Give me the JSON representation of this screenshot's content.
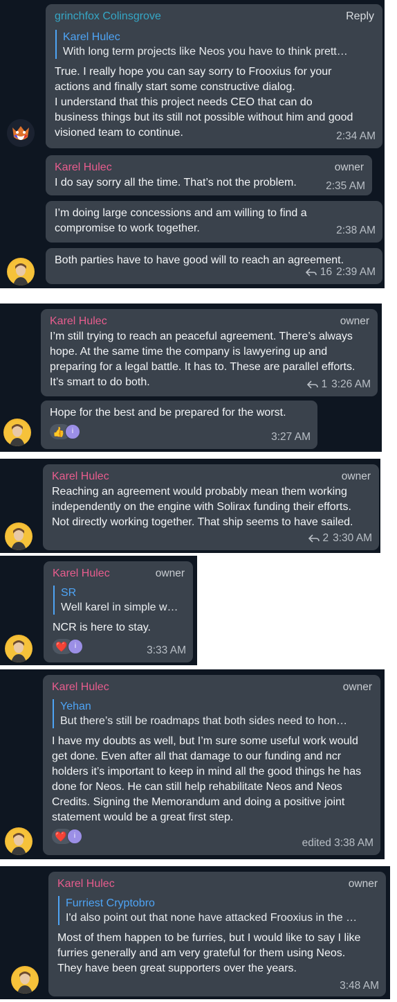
{
  "colors": {
    "background": "#0e1621",
    "bubble": "#3a424c",
    "owner_name": "#e85d8e",
    "other_name": "#35a7c6",
    "quote_bar": "#4ea4f5"
  },
  "panel1": {
    "msg1": {
      "author": "grinchfox Colinsgrove",
      "reply_label": "Reply",
      "quote_author": "Karel Hulec",
      "quote_text": "With long term projects like Neos you have to think prett…",
      "text": "True. I really hope you can say sorry to Frooxius for your actions and finally start some constructive dialog.\nI understand that this project needs CEO that can do business things but its still not possible without him and good visioned team to continue.",
      "time": "2:34 AM"
    },
    "msg2": {
      "author": "Karel Hulec",
      "badge": "owner",
      "text": "I do say sorry all the time. That’s not the problem.",
      "time": "2:35 AM"
    },
    "msg3": {
      "text": "I’m doing large concessions and am willing to find a compromise to work together.",
      "time": "2:38 AM"
    },
    "msg4": {
      "text": "Both parties have to have good will to reach an agreement.",
      "replies": "16",
      "time": "2:39 AM"
    }
  },
  "panel2": {
    "msg1": {
      "author": "Karel Hulec",
      "badge": "owner",
      "text": "I’m still trying to reach an peaceful agreement. There’s always hope. At the same time the company is lawyering up and preparing for a legal battle. It has to. These are parallel efforts. It’s smart to do both.",
      "replies": "1",
      "time": "3:26 AM"
    },
    "msg2": {
      "text": "Hope for the best and be prepared for the worst.",
      "reaction": "👍",
      "time": "3:27 AM"
    }
  },
  "panel3": {
    "msg1": {
      "author": "Karel Hulec",
      "badge": "owner",
      "text": "Reaching an agreement would probably mean them working independently on the engine with Solirax funding their efforts. Not directly working together. That ship seems to have sailed.",
      "replies": "2",
      "time": "3:30 AM"
    }
  },
  "panel4": {
    "msg1": {
      "author": "Karel Hulec",
      "badge": "owner",
      "quote_author": "SR",
      "quote_text": "Well karel in simple w…",
      "text": "NCR is here to stay.",
      "reaction": "❤️",
      "time": "3:33 AM"
    }
  },
  "panel5": {
    "msg1": {
      "author": "Karel Hulec",
      "badge": "owner",
      "quote_author": "Yehan",
      "quote_text": "But there’s still be roadmaps that both sides need to hon…",
      "text": "I have my doubts as well, but I’m sure some useful work would get done. Even after all that damage to our funding and ncr holders it’s important to keep in mind all the good things he has done for Neos. He can still help rehabilitate Neos and Neos Credits. Signing the Memorandum and doing a positive joint statement would be a great first step.",
      "reaction": "❤️",
      "time": "edited 3:38 AM"
    }
  },
  "panel6": {
    "msg1": {
      "author": "Karel Hulec",
      "badge": "owner",
      "quote_author": "Furriest Cryptobro",
      "quote_text": "I'd also point out that none have attacked Frooxius in the …",
      "text": "Most of them happen to be furries, but I would like to say I like furries generally and am very grateful for them using Neos. They have been great supporters over the years.",
      "time": "3:48 AM"
    }
  },
  "icons": {
    "reply": "reply-arrow-icon",
    "reactor": "reactor-avatar-icon"
  }
}
